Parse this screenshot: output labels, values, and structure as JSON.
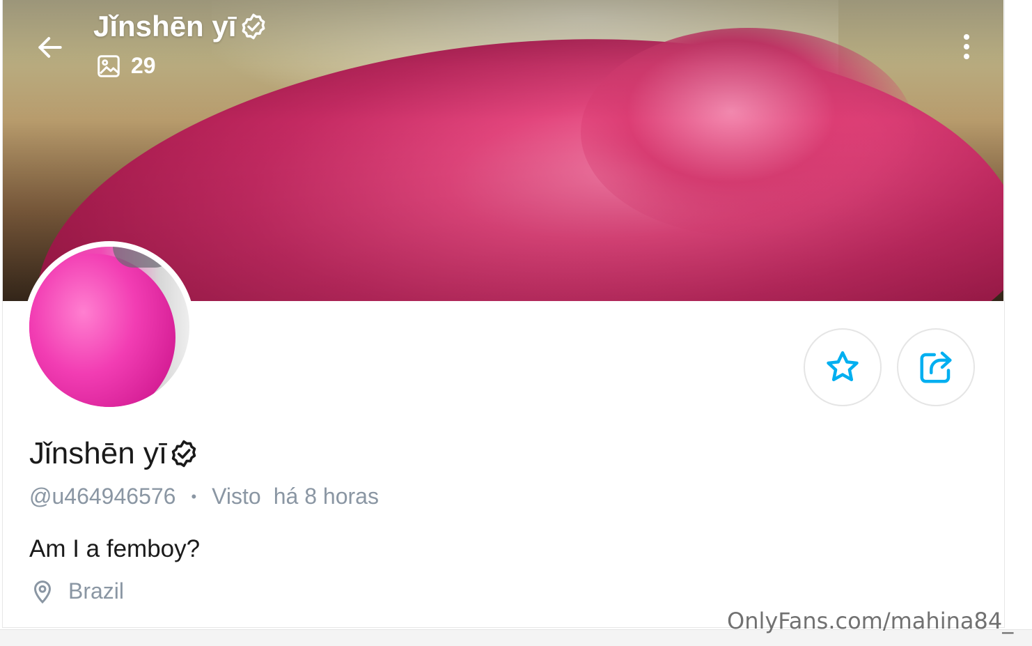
{
  "header": {
    "name": "Jǐnshēn yī",
    "media_count": "29"
  },
  "profile": {
    "name": "Jǐnshēn yī",
    "username": "@u464946576",
    "separator": "•",
    "seen_label": "Visto",
    "seen_time": "há 8 horas",
    "bio": "Am I a femboy?",
    "location": "Brazil"
  },
  "watermark": "OnlyFans.com/mahina84_",
  "colors": {
    "accent": "#00aff0",
    "muted_text": "#8a96a3",
    "primary_text": "#1a1a1a"
  },
  "icons": {
    "back": "arrow-left-icon",
    "media": "image-icon",
    "verified": "verified-badge-icon",
    "more": "more-vertical-icon",
    "favorite": "star-icon",
    "share": "share-icon",
    "location": "map-pin-icon"
  }
}
